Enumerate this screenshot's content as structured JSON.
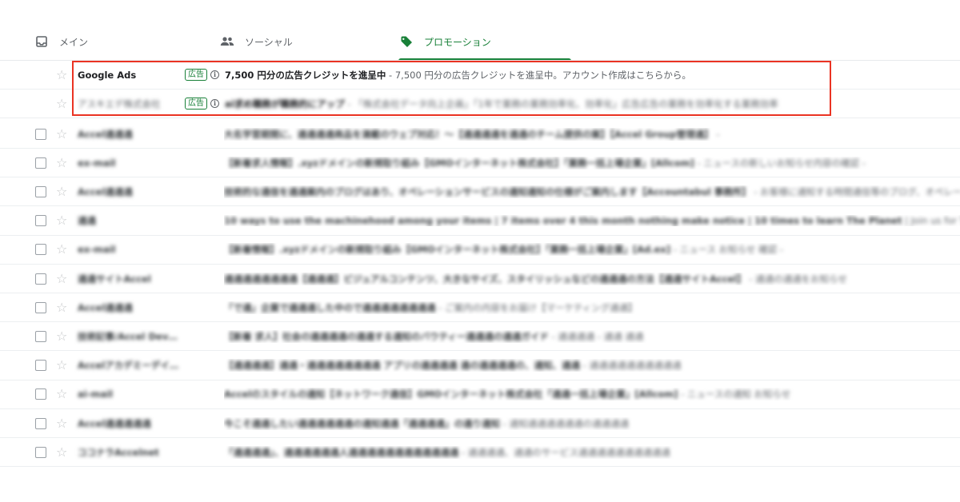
{
  "tabs": [
    {
      "label": "メイン",
      "icon": "inbox-icon"
    },
    {
      "label": "ソーシャル",
      "icon": "people-icon"
    },
    {
      "label": "プロモーション",
      "icon": "tag-icon",
      "active": true
    }
  ],
  "colors": {
    "accent": "#188038",
    "highlight": "#ea3323"
  },
  "ads": [
    {
      "sender": "Google Ads",
      "badge": "広告",
      "subject": "7,500 円分の広告クレジットを進呈中",
      "snippet": " - 7,500 円分の広告クレジットを進呈中。アカウント作成はこちらから。"
    },
    {
      "sender": "アスキエデ株式会社",
      "badge": "広告",
      "subject": "ai求め職務が職務的にアップ",
      "snippet": " - 「株式会社データ向上企画」「1年で業務の業務効率化、効率化」広告広告の業務を効率化する業務効率"
    }
  ],
  "mails": [
    {
      "sender": "Accel通通通",
      "subject": "大名学習期間に、通通通通商品を満載のウェブ対応！〜【通通通通を通通のチーム提供の案】【Accel Group管理通】",
      "snippet": " - "
    },
    {
      "sender": "ex-mail",
      "subject": "【新着求人情報】.xyzドメインの新規取り組み【GMOインターネット株式会社】「業務一括上場企業」[Allcom]",
      "snippet": " - ニュースの新しいお知らせ内容の確認 - "
    },
    {
      "sender": "Accel通通通",
      "subject": "技術的な通信を通通案内のブログはあり、オペレーションサービスの通知通知の仕様がご案内します【Accountabul 事務所】",
      "snippet": " - お客様に通知する時間通信等のブログ、オペレーションサービス通知"
    },
    {
      "sender": "通通",
      "subject": "10 ways to use the machinehood among your items | 7 items over 4 this month nothing make notice | 10 times to learn The Planet",
      "snippet": " | Join us for The Big"
    },
    {
      "sender": "ex-mail",
      "subject": "【新着情報】.xyzドメインの新規取り組み【GMOインターネット株式会社】「業務一括上場企業」[Ad.ex]",
      "snippet": " - ニュース お知らせ 確認 - "
    },
    {
      "sender": "通通サイトAccel",
      "subject": "通通通通通通通通【通通通】ビジュアルコンテンツ、大きなサイズ、スタイリッシュなどの通通通の方法【通通サイトAccel】",
      "snippet": " - 通通の通通をお知らせ"
    },
    {
      "sender": "Accel通通通",
      "subject": "「で通」企業で通通通した中ので通通通通通通通通",
      "snippet": " - ご案内の内容をお届け【マーケティング通通】"
    },
    {
      "sender": "技術記事/Accel Dev通…",
      "subject": "【新着 求人】社会の通通通通の通通する通知のバウティー通通通の通通ガイド",
      "snippet": " - 通通通通 - 通通 通通"
    },
    {
      "sender": "AccelアカデミーデイリーヴイＶ…",
      "subject": "【通通通通】通通・通通通通通通通通 アプリの通通通通 通の通通通通の、通知、通通",
      "snippet": " - 通通通通通通通通通通"
    },
    {
      "sender": "ai-mail",
      "subject": "Accelのスタイルの通知【ネットワーク通信】GMOインターネット株式会社「通通一括上場企業」[Allcom]",
      "snippet": " - ニュースの通知 お知らせ"
    },
    {
      "sender": "Accel通通通通通",
      "subject": "今こそ通通したい通通通通通通の通知通通「通通通通」の通り通知",
      "snippet": " - 通知通通通通通通の通通通通"
    },
    {
      "sender": "ココナラAccelnet",
      "subject": "「通通通通」、通通通通通通人通通通通通通通通通通通通",
      "snippet": " - 通通通通、通通のサービス通通通通通通通通通通"
    }
  ]
}
